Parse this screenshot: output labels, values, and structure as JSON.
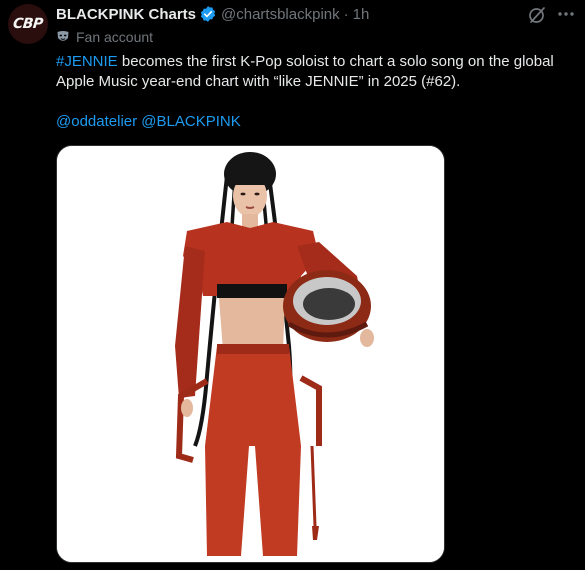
{
  "author": {
    "avatar_text": "CBP",
    "display_name": "BLACKPINK Charts",
    "handle": "@chartsblackpink",
    "separator": "·",
    "time": "1h",
    "account_label": "Fan account"
  },
  "tweet": {
    "hashtag": "#JENNIE",
    "body": " becomes the first K-Pop soloist to chart a solo song on the global Apple Music year-end chart with “like JENNIE” in 2025 (#62).",
    "mentions": [
      "@oddatelier",
      "@BLACKPINK"
    ]
  },
  "colors": {
    "background": "#000000",
    "text": "#e7e9ea",
    "muted": "#71767b",
    "link": "#1d9bf0",
    "outfit": "#b8331f"
  },
  "icons": {
    "verified": "verified-badge-icon",
    "grok": "grok-icon",
    "more": "more-options-icon",
    "fan": "fan-mask-icon"
  }
}
